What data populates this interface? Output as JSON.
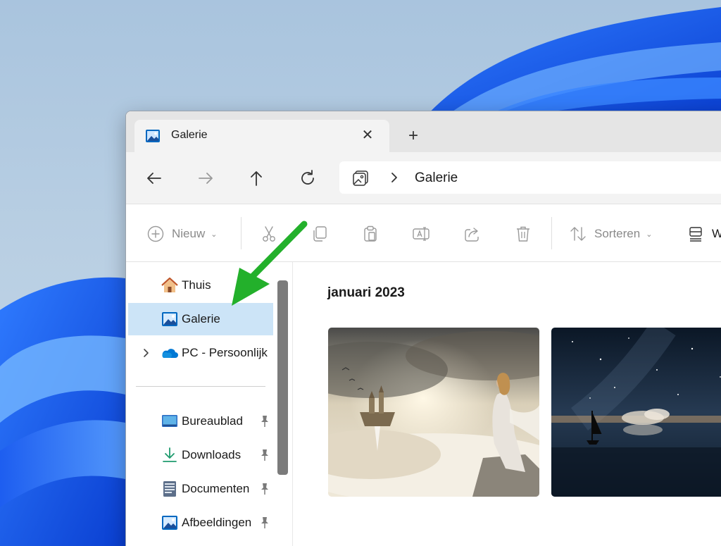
{
  "tab": {
    "title": "Galerie",
    "close_glyph": "✕",
    "new_tab_glyph": "+"
  },
  "address": {
    "current": "Galerie"
  },
  "toolbar": {
    "new_label": "Nieuw",
    "sort_label": "Sorteren",
    "view_label_partial": "W"
  },
  "sidebar": {
    "items": [
      {
        "label": "Thuis",
        "icon": "home-icon"
      },
      {
        "label": "Galerie",
        "icon": "gallery-icon",
        "selected": true
      },
      {
        "label": "PC - Persoonlijk",
        "icon": "onedrive-cloud-icon",
        "expandable": true
      }
    ],
    "pinned": [
      {
        "label": "Bureaublad",
        "icon": "desktop-icon"
      },
      {
        "label": "Downloads",
        "icon": "download-icon"
      },
      {
        "label": "Documenten",
        "icon": "documents-icon"
      },
      {
        "label": "Afbeeldingen",
        "icon": "pictures-icon"
      }
    ]
  },
  "gallery": {
    "group_heading": "januari 2023"
  },
  "colors": {
    "selected_bg": "#cce4f7",
    "accent_blue": "#0067c0",
    "arrow_green": "#23b02b"
  }
}
